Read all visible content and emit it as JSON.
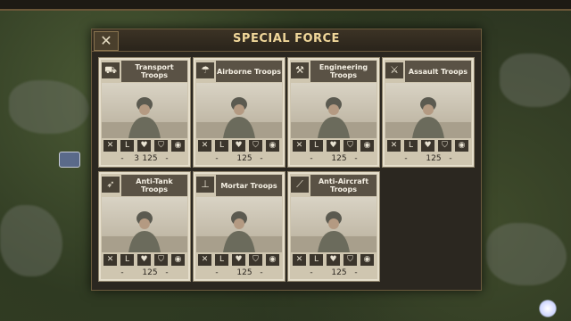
{
  "dialog": {
    "title": "SPECIAL FORCE",
    "close_label": "✕"
  },
  "cards": [
    {
      "name": "Transport Troops",
      "icon": "truck",
      "count": "3",
      "cost": "125"
    },
    {
      "name": "Airborne Troops",
      "icon": "parachute",
      "count": "",
      "cost": "125"
    },
    {
      "name": "Engineering Troops",
      "icon": "shovel",
      "count": "",
      "cost": "125"
    },
    {
      "name": "Assault Troops",
      "icon": "rifle",
      "count": "",
      "cost": "125"
    },
    {
      "name": "Anti-Tank Troops",
      "icon": "rocket-launcher",
      "count": "",
      "cost": "125"
    },
    {
      "name": "Mortar Troops",
      "icon": "mortar",
      "count": "",
      "cost": "125"
    },
    {
      "name": "Anti-Aircraft Troops",
      "icon": "flak-gun",
      "count": "",
      "cost": "125"
    }
  ],
  "stat_icons": [
    "crossed-swords",
    "boot",
    "heart",
    "shield",
    "eye"
  ],
  "cost_dash": "-"
}
